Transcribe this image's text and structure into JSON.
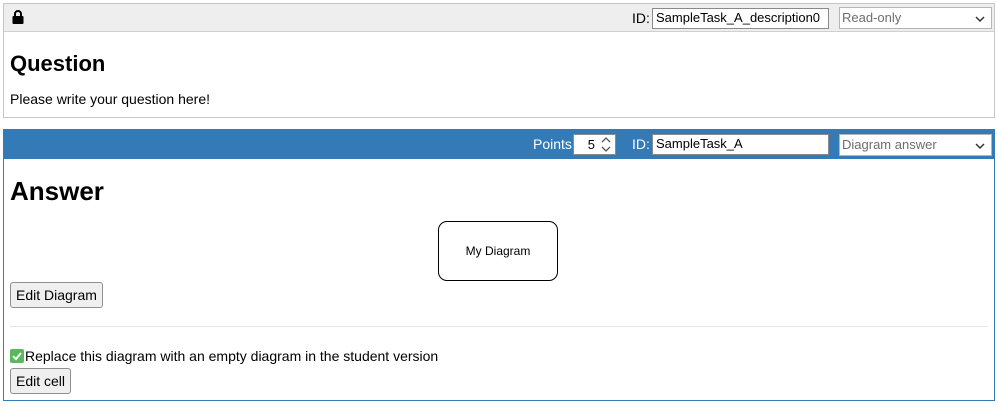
{
  "question_cell": {
    "id_label": "ID:",
    "id_value": "SampleTask_A_description0",
    "mode_select": "Read-only",
    "title": "Question",
    "text": "Please write your question here!"
  },
  "answer_cell": {
    "points_label": "Points:",
    "points_value": "5",
    "id_label": "ID:",
    "id_value": "SampleTask_A",
    "type_select": "Diagram answer",
    "title": "Answer",
    "diagram_label": "My Diagram",
    "edit_diagram_button": "Edit Diagram",
    "checkbox_label": "Replace this diagram with an empty diagram in the student version",
    "checkbox_checked": true,
    "edit_cell_button": "Edit cell"
  },
  "colors": {
    "answer_accent": "#337ab7",
    "question_toolbar": "#eeeeee",
    "checkbox_green": "#5cb85c"
  },
  "icons": [
    "lock-icon",
    "chevron-down-icon",
    "spinner-icon",
    "checkbox-checked-icon"
  ]
}
